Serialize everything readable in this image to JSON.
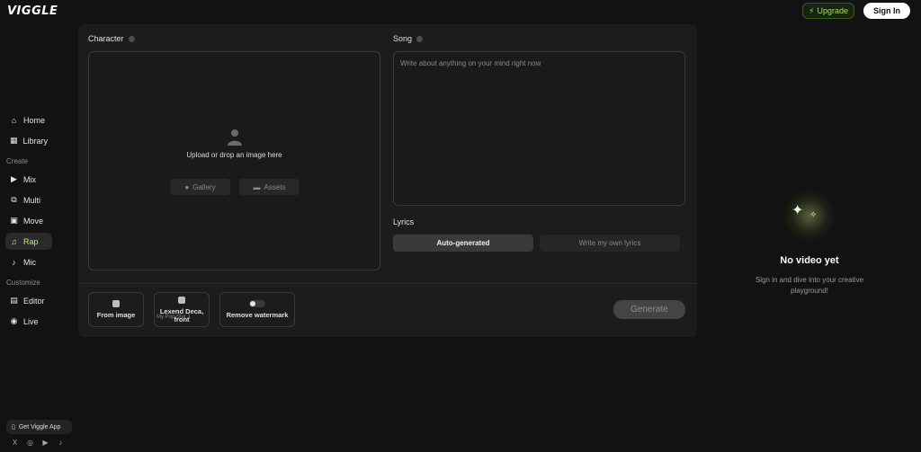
{
  "brand": {
    "logo": "VIGGLE"
  },
  "header": {
    "upgrade_label": "Upgrade",
    "signin_label": "Sign In"
  },
  "sidebar": {
    "items": [
      {
        "label": "Home",
        "icon": "home-icon"
      },
      {
        "label": "Library",
        "icon": "library-icon"
      }
    ],
    "create_label": "Create",
    "create_items": [
      {
        "label": "Mix",
        "icon": "mix-icon"
      },
      {
        "label": "Multi",
        "icon": "multi-icon"
      },
      {
        "label": "Move",
        "icon": "move-icon"
      },
      {
        "label": "Rap",
        "icon": "rap-icon",
        "active": true
      },
      {
        "label": "Mic",
        "icon": "mic-icon"
      }
    ],
    "customize_label": "Customize",
    "customize_items": [
      {
        "label": "Editor",
        "icon": "editor-icon"
      },
      {
        "label": "Live",
        "icon": "live-icon"
      }
    ],
    "get_app_label": "Get Viggle App"
  },
  "character": {
    "label": "Character",
    "upload_text": "Upload or drop an image here",
    "gallery_label": "Gallery",
    "assets_label": "Assets"
  },
  "song": {
    "label": "Song",
    "placeholder": "Write about anything on your mind right now"
  },
  "lyrics": {
    "label": "Lyrics",
    "auto_label": "Auto-generated",
    "own_label": "Write my own lyrics"
  },
  "options": {
    "from_image_label": "From image",
    "font_title": "Lexend Deca, front",
    "font_sub": "My Pop Star 1",
    "watermark_label": "Remove watermark"
  },
  "generate_label": "Generate",
  "empty_state": {
    "title": "No video yet",
    "subtitle": "Sign in and dive into your creative playground!"
  },
  "colors": {
    "accent": "#b9ef6b",
    "background": "#121212",
    "panel": "#1c1c1c"
  }
}
